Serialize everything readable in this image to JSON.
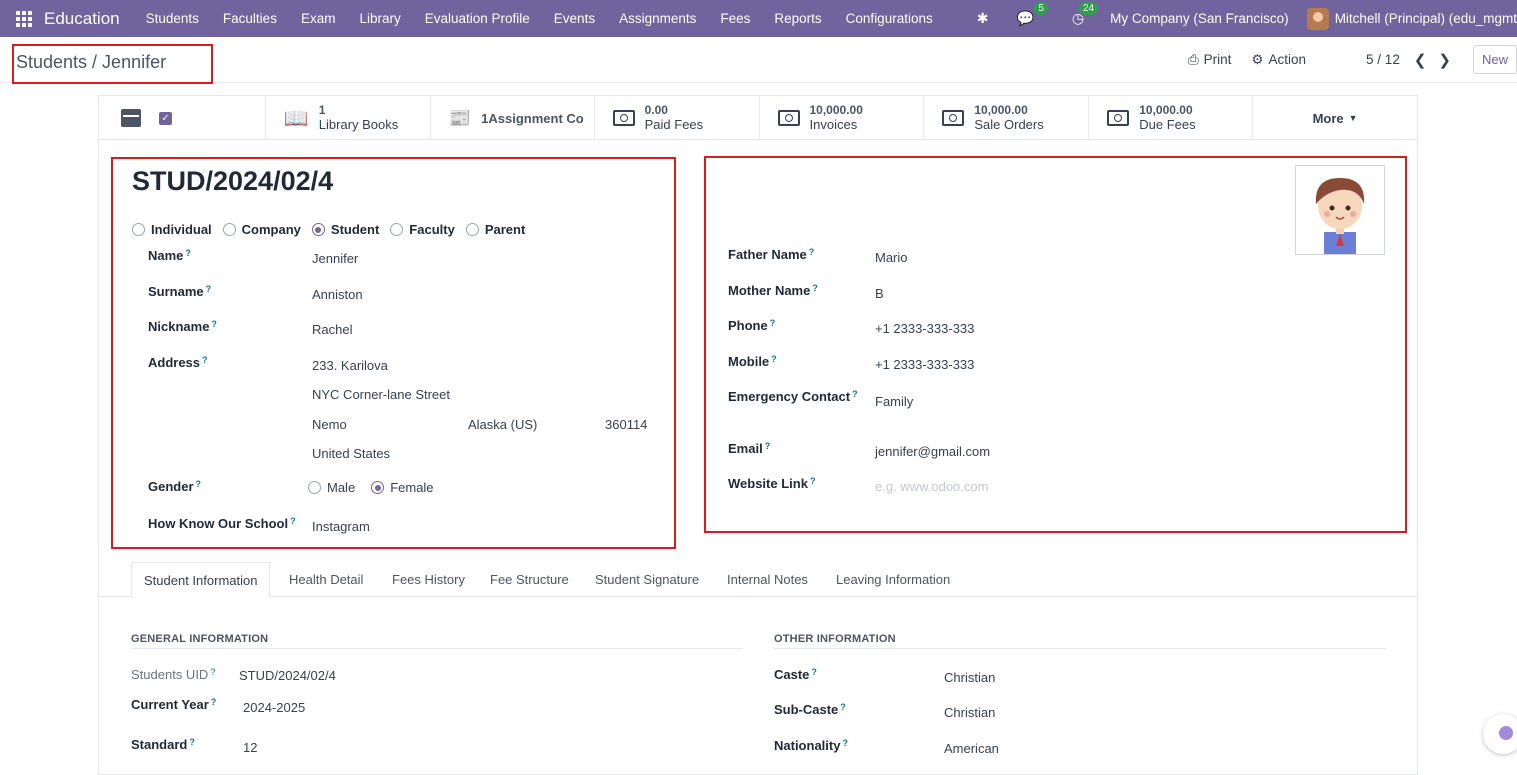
{
  "navbar": {
    "brand": "Education",
    "menu": [
      "Students",
      "Faculties",
      "Exam",
      "Library",
      "Evaluation Profile",
      "Events",
      "Assignments",
      "Fees",
      "Reports",
      "Configurations"
    ],
    "messages_badge": "5",
    "activities_badge": "24",
    "company": "My Company (San Francisco)",
    "user": "Mitchell (Principal) (edu_mgmt"
  },
  "control": {
    "breadcrumb": "Students / Jennifer",
    "print": "Print",
    "action": "Action",
    "pager": "5 / 12",
    "new": "New"
  },
  "stats": {
    "library_value": "1",
    "library_label": "Library Books",
    "assignment_label": "1Assignment Co",
    "paid_value": "0.00",
    "paid_label": "Paid Fees",
    "invoices_value": "10,000.00",
    "invoices_label": "Invoices",
    "sale_value": "10,000.00",
    "sale_label": "Sale Orders",
    "due_value": "10,000.00",
    "due_label": "Due Fees",
    "more": "More"
  },
  "record": {
    "reference": "STUD/2024/02/4",
    "partner_types": [
      "Individual",
      "Company",
      "Student",
      "Faculty",
      "Parent"
    ],
    "selected_type": "Student"
  },
  "left_fields": {
    "name_label": "Name",
    "name": "Jennifer",
    "surname_label": "Surname",
    "surname": "Anniston",
    "nickname_label": "Nickname",
    "nickname": "Rachel",
    "address_label": "Address",
    "street": "233. Karilova",
    "street2": "NYC Corner-lane Street",
    "city": "Nemo",
    "state": "Alaska (US)",
    "zip": "360114",
    "country": "United States",
    "gender_label": "Gender",
    "gender_male": "Male",
    "gender_female": "Female",
    "how_know_label": "How Know Our School",
    "how_know": "Instagram"
  },
  "right_fields": {
    "father_label": "Father Name",
    "father": "Mario",
    "mother_label": "Mother Name",
    "mother": "B",
    "phone_label": "Phone",
    "phone": "+1 2333-333-333",
    "mobile_label": "Mobile",
    "mobile": "+1 2333-333-333",
    "emergency_label": "Emergency Contact",
    "emergency": "Family",
    "email_label": "Email",
    "email": "jennifer@gmail.com",
    "website_label": "Website Link",
    "website_placeholder": "e.g. www.odoo.com"
  },
  "tabs": [
    "Student Information",
    "Health Detail",
    "Fees History",
    "Fee Structure",
    "Student Signature",
    "Internal Notes",
    "Leaving Information"
  ],
  "general": {
    "title": "GENERAL INFORMATION",
    "uid_label": "Students UID",
    "uid": "STUD/2024/02/4",
    "year_label": "Current Year",
    "year": "2024-2025",
    "standard_label": "Standard",
    "standard": "12"
  },
  "other": {
    "title": "OTHER INFORMATION",
    "caste_label": "Caste",
    "caste": "Christian",
    "subcaste_label": "Sub-Caste",
    "subcaste": "Christian",
    "nationality_label": "Nationality",
    "nationality": "American"
  },
  "colors": {
    "navbar": "#71639e",
    "highlight_border": "#d81b1b",
    "badge": "#2e9f4f"
  }
}
